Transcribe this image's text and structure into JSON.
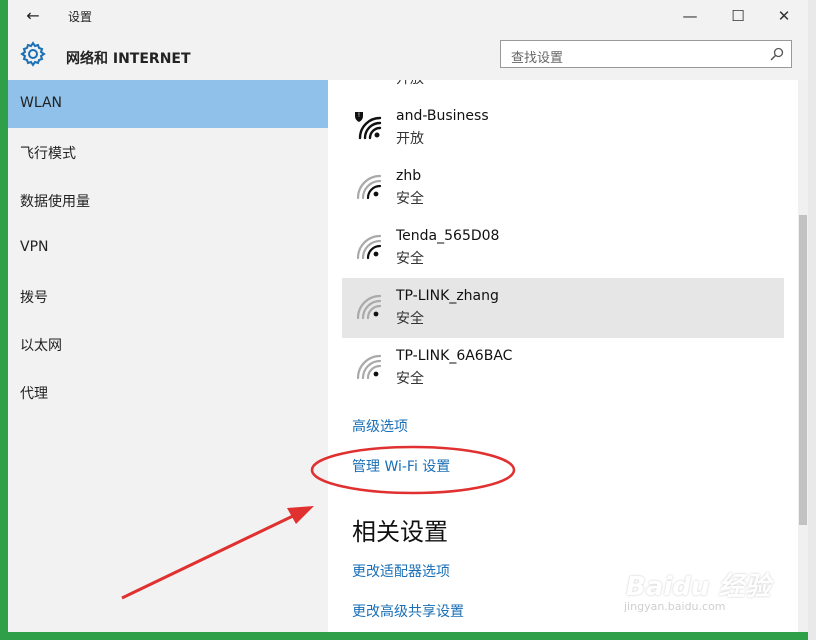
{
  "window": {
    "title": "设置",
    "back_glyph": "←",
    "minimize_glyph": "—",
    "maximize_glyph": "☐",
    "close_glyph": "✕"
  },
  "header": {
    "icon": "gear-icon",
    "title": "网络和 INTERNET",
    "search_placeholder": "查找设置",
    "search_icon": "search-icon"
  },
  "sidebar": {
    "items": [
      {
        "label": "WLAN",
        "active": true
      },
      {
        "label": "飞行模式"
      },
      {
        "label": "数据使用量"
      },
      {
        "label": "VPN"
      },
      {
        "label": "拨号"
      },
      {
        "label": "以太网"
      },
      {
        "label": "代理"
      }
    ]
  },
  "networks": [
    {
      "ssid": "",
      "status": "开放",
      "secured_badge": false
    },
    {
      "ssid": "and-Business",
      "status": "开放",
      "secured_badge": true
    },
    {
      "ssid": "zhb",
      "status": "安全"
    },
    {
      "ssid": "Tenda_565D08",
      "status": "安全"
    },
    {
      "ssid": "TP-LINK_zhang",
      "status": "安全",
      "selected": true
    },
    {
      "ssid": "TP-LINK_6A6BAC",
      "status": "安全"
    }
  ],
  "links": {
    "advanced": "高级选项",
    "manage_wifi": "管理 Wi-Fi 设置",
    "related_heading": "相关设置",
    "adapter": "更改适配器选项",
    "sharing": "更改高级共享设置"
  },
  "watermark": {
    "logo": "Baidu 经验",
    "url": "jingyan.baidu.com"
  },
  "colors": {
    "accent_link": "#1a6fb5",
    "active_nav": "#8fc1ea",
    "annotation_red": "#e03030",
    "frame_green": "#2f9f49"
  }
}
